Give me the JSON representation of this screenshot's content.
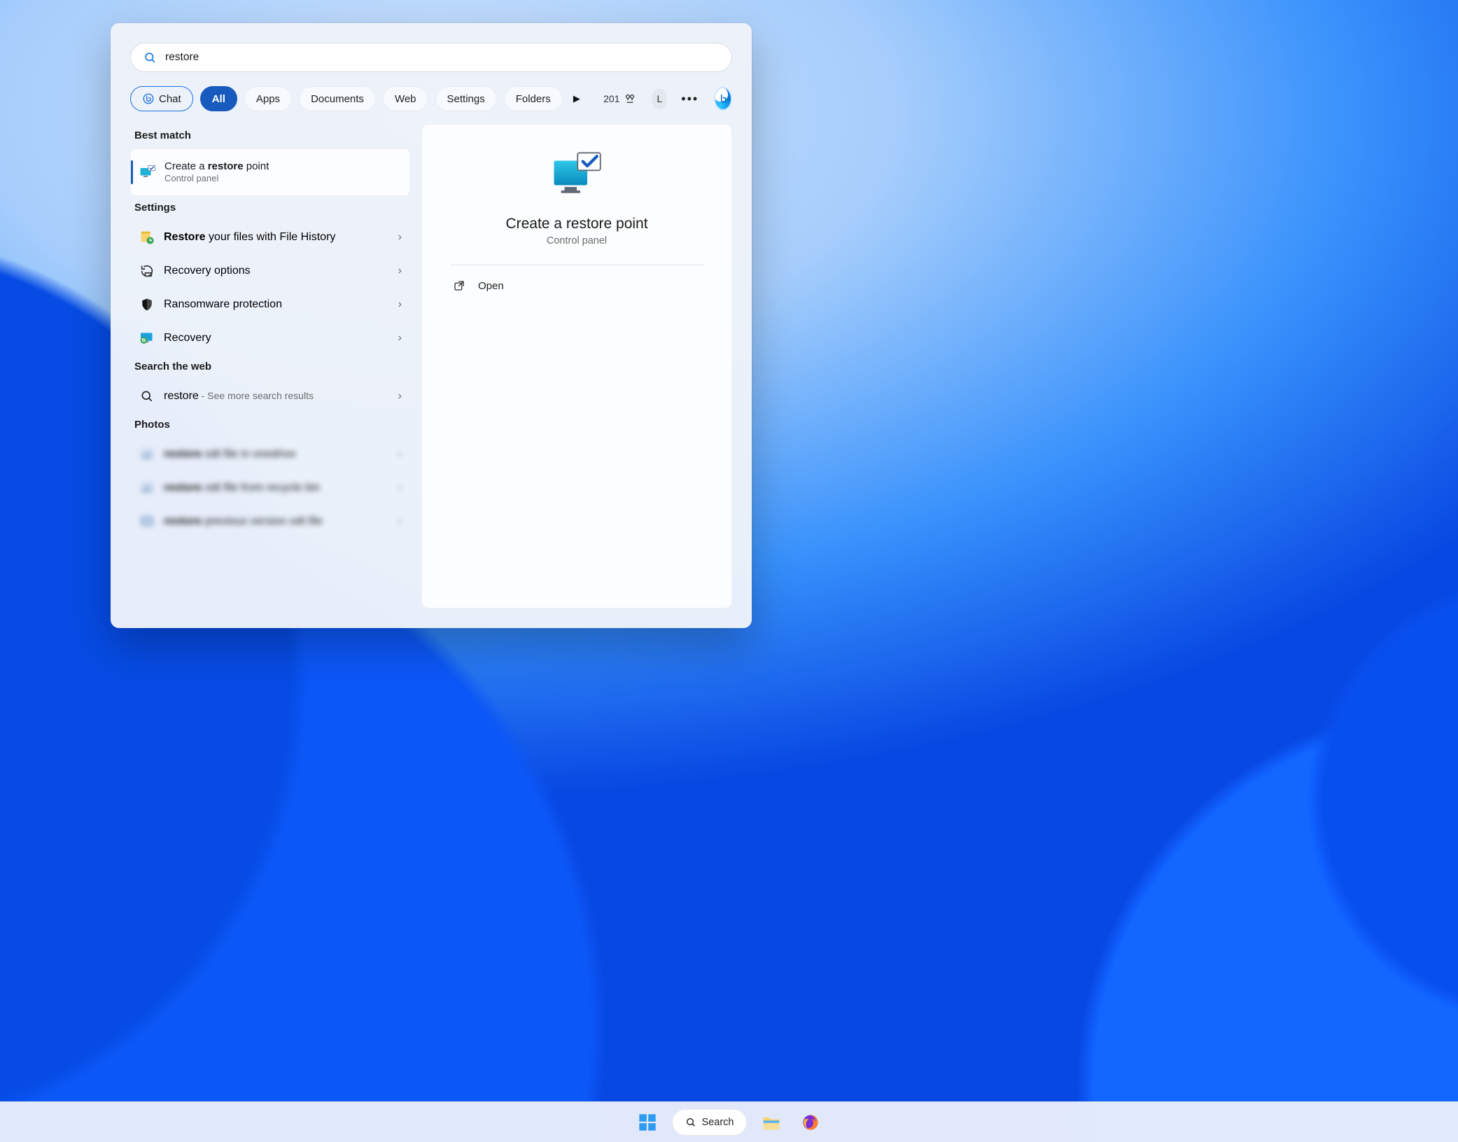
{
  "search": {
    "query": "restore"
  },
  "filters": {
    "chat": "Chat",
    "all": "All",
    "apps": "Apps",
    "documents": "Documents",
    "web": "Web",
    "settings": "Settings",
    "folders": "Folders"
  },
  "toolbar": {
    "points": "201",
    "avatar_initial": "L"
  },
  "left": {
    "best_match_header": "Best match",
    "best_match": {
      "title_pre": "Create a ",
      "title_bold": "restore",
      "title_post": " point",
      "subtitle": "Control panel"
    },
    "settings_header": "Settings",
    "settings_items": [
      {
        "bold": "Restore",
        "rest": " your files with File History"
      },
      {
        "bold": "",
        "rest": "Recovery options"
      },
      {
        "bold": "",
        "rest": "Ransomware protection"
      },
      {
        "bold": "",
        "rest": "Recovery"
      }
    ],
    "web_header": "Search the web",
    "web_item": {
      "query": "restore",
      "suffix": " - See more search results"
    },
    "photos_header": "Photos",
    "photos_items": [
      {
        "bold": "restore",
        "rest": " odt file in onedrive"
      },
      {
        "bold": "restore",
        "rest": " odt file from recycle bin"
      },
      {
        "bold": "restore",
        "rest": " previous version odt file"
      }
    ]
  },
  "right": {
    "title": "Create a restore point",
    "subtitle": "Control panel",
    "open_label": "Open"
  },
  "taskbar": {
    "search_label": "Search"
  }
}
